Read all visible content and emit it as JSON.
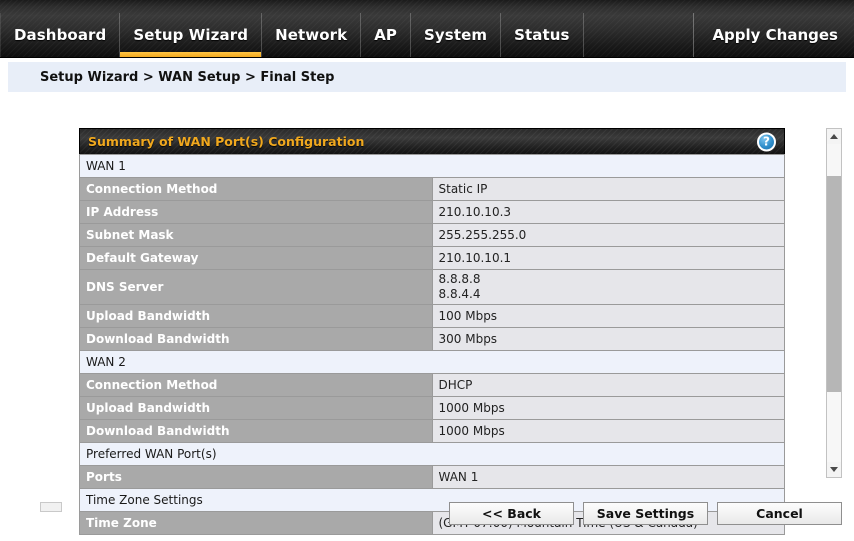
{
  "nav": {
    "items": [
      {
        "label": "Dashboard",
        "active": false
      },
      {
        "label": "Setup Wizard",
        "active": true
      },
      {
        "label": "Network",
        "active": false
      },
      {
        "label": "AP",
        "active": false
      },
      {
        "label": "System",
        "active": false
      },
      {
        "label": "Status",
        "active": false
      }
    ],
    "apply_changes_label": "Apply Changes"
  },
  "breadcrumb": {
    "text": "Setup Wizard > WAN Setup > Final Step"
  },
  "panel": {
    "title": "Summary of WAN Port(s) Configuration",
    "help_icon": "help-question-icon",
    "help_glyph": "?"
  },
  "table": {
    "rows": [
      {
        "type": "section",
        "label": "WAN 1"
      },
      {
        "type": "kv",
        "label": "Connection Method",
        "value": "Static IP"
      },
      {
        "type": "kv",
        "label": "IP Address",
        "value": "210.10.10.3"
      },
      {
        "type": "kv",
        "label": "Subnet Mask",
        "value": "255.255.255.0"
      },
      {
        "type": "kv",
        "label": "Default Gateway",
        "value": "210.10.10.1"
      },
      {
        "type": "kv-multi",
        "label": "DNS Server",
        "values": [
          "8.8.8.8",
          "8.8.4.4"
        ]
      },
      {
        "type": "kv",
        "label": "Upload Bandwidth",
        "value": "100 Mbps"
      },
      {
        "type": "kv",
        "label": "Download Bandwidth",
        "value": "300 Mbps"
      },
      {
        "type": "section",
        "label": "WAN 2"
      },
      {
        "type": "kv",
        "label": "Connection Method",
        "value": "DHCP"
      },
      {
        "type": "kv",
        "label": "Upload Bandwidth",
        "value": "1000 Mbps"
      },
      {
        "type": "kv",
        "label": "Download Bandwidth",
        "value": "1000 Mbps"
      },
      {
        "type": "section",
        "label": "Preferred WAN Port(s)"
      },
      {
        "type": "kv",
        "label": "Ports",
        "value": "WAN 1"
      },
      {
        "type": "section",
        "label": "Time Zone Settings"
      },
      {
        "type": "kv",
        "label": "Time Zone",
        "value": "(GMT-07:00) Mountain Time (US & Canada)"
      }
    ]
  },
  "scrollbar": {
    "up_icon": "scroll-up-arrow-icon",
    "down_icon": "scroll-down-arrow-icon"
  },
  "footer": {
    "back_label": "<< Back",
    "save_label": "Save Settings",
    "cancel_label": "Cancel"
  },
  "colors": {
    "accent_orange": "#f0a81e",
    "nav_dark": "#2a2a2a",
    "breadcrumb_bg": "#e8eef8",
    "label_cell": "#a9a9a9",
    "value_cell": "#e6e6ea",
    "section_cell": "#eef2fb",
    "help_blue": "#2f8ecb"
  }
}
